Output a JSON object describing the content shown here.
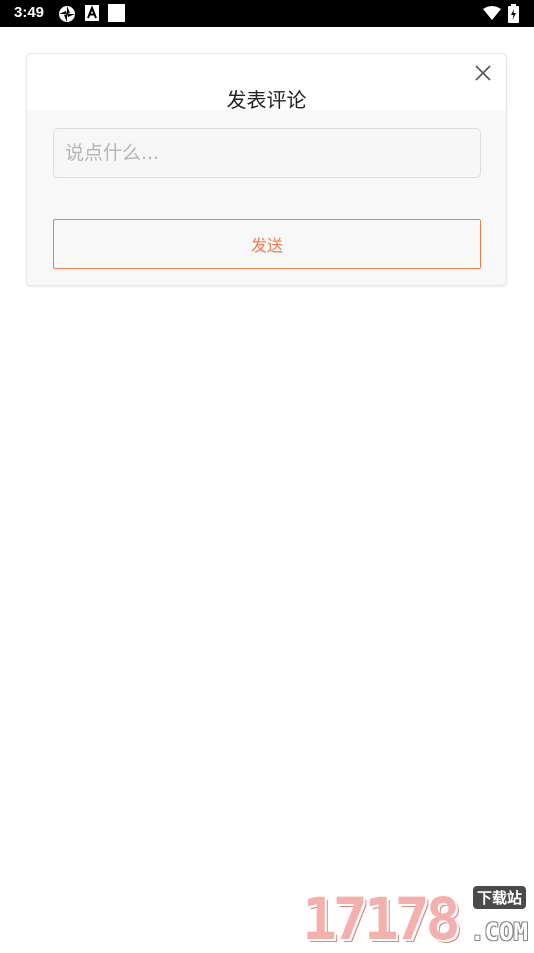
{
  "status_bar": {
    "time": "3:49",
    "icons": [
      "aperture-icon",
      "a-badge-icon",
      "white-square-icon",
      "wifi-icon",
      "battery-charging-icon"
    ]
  },
  "dialog": {
    "title": "发表评论",
    "close_icon": "close-icon",
    "input": {
      "value": "",
      "placeholder": "说点什么..."
    },
    "send_label": "发送"
  },
  "colors": {
    "accent": "#f07c4b",
    "status_bar_bg": "#000000",
    "dialog_bg": "#f8f8f8",
    "watermark_pink": "#f3b0ad"
  },
  "watermark": {
    "main": "17178",
    "suffix": ".COM",
    "tag": "下载站"
  }
}
